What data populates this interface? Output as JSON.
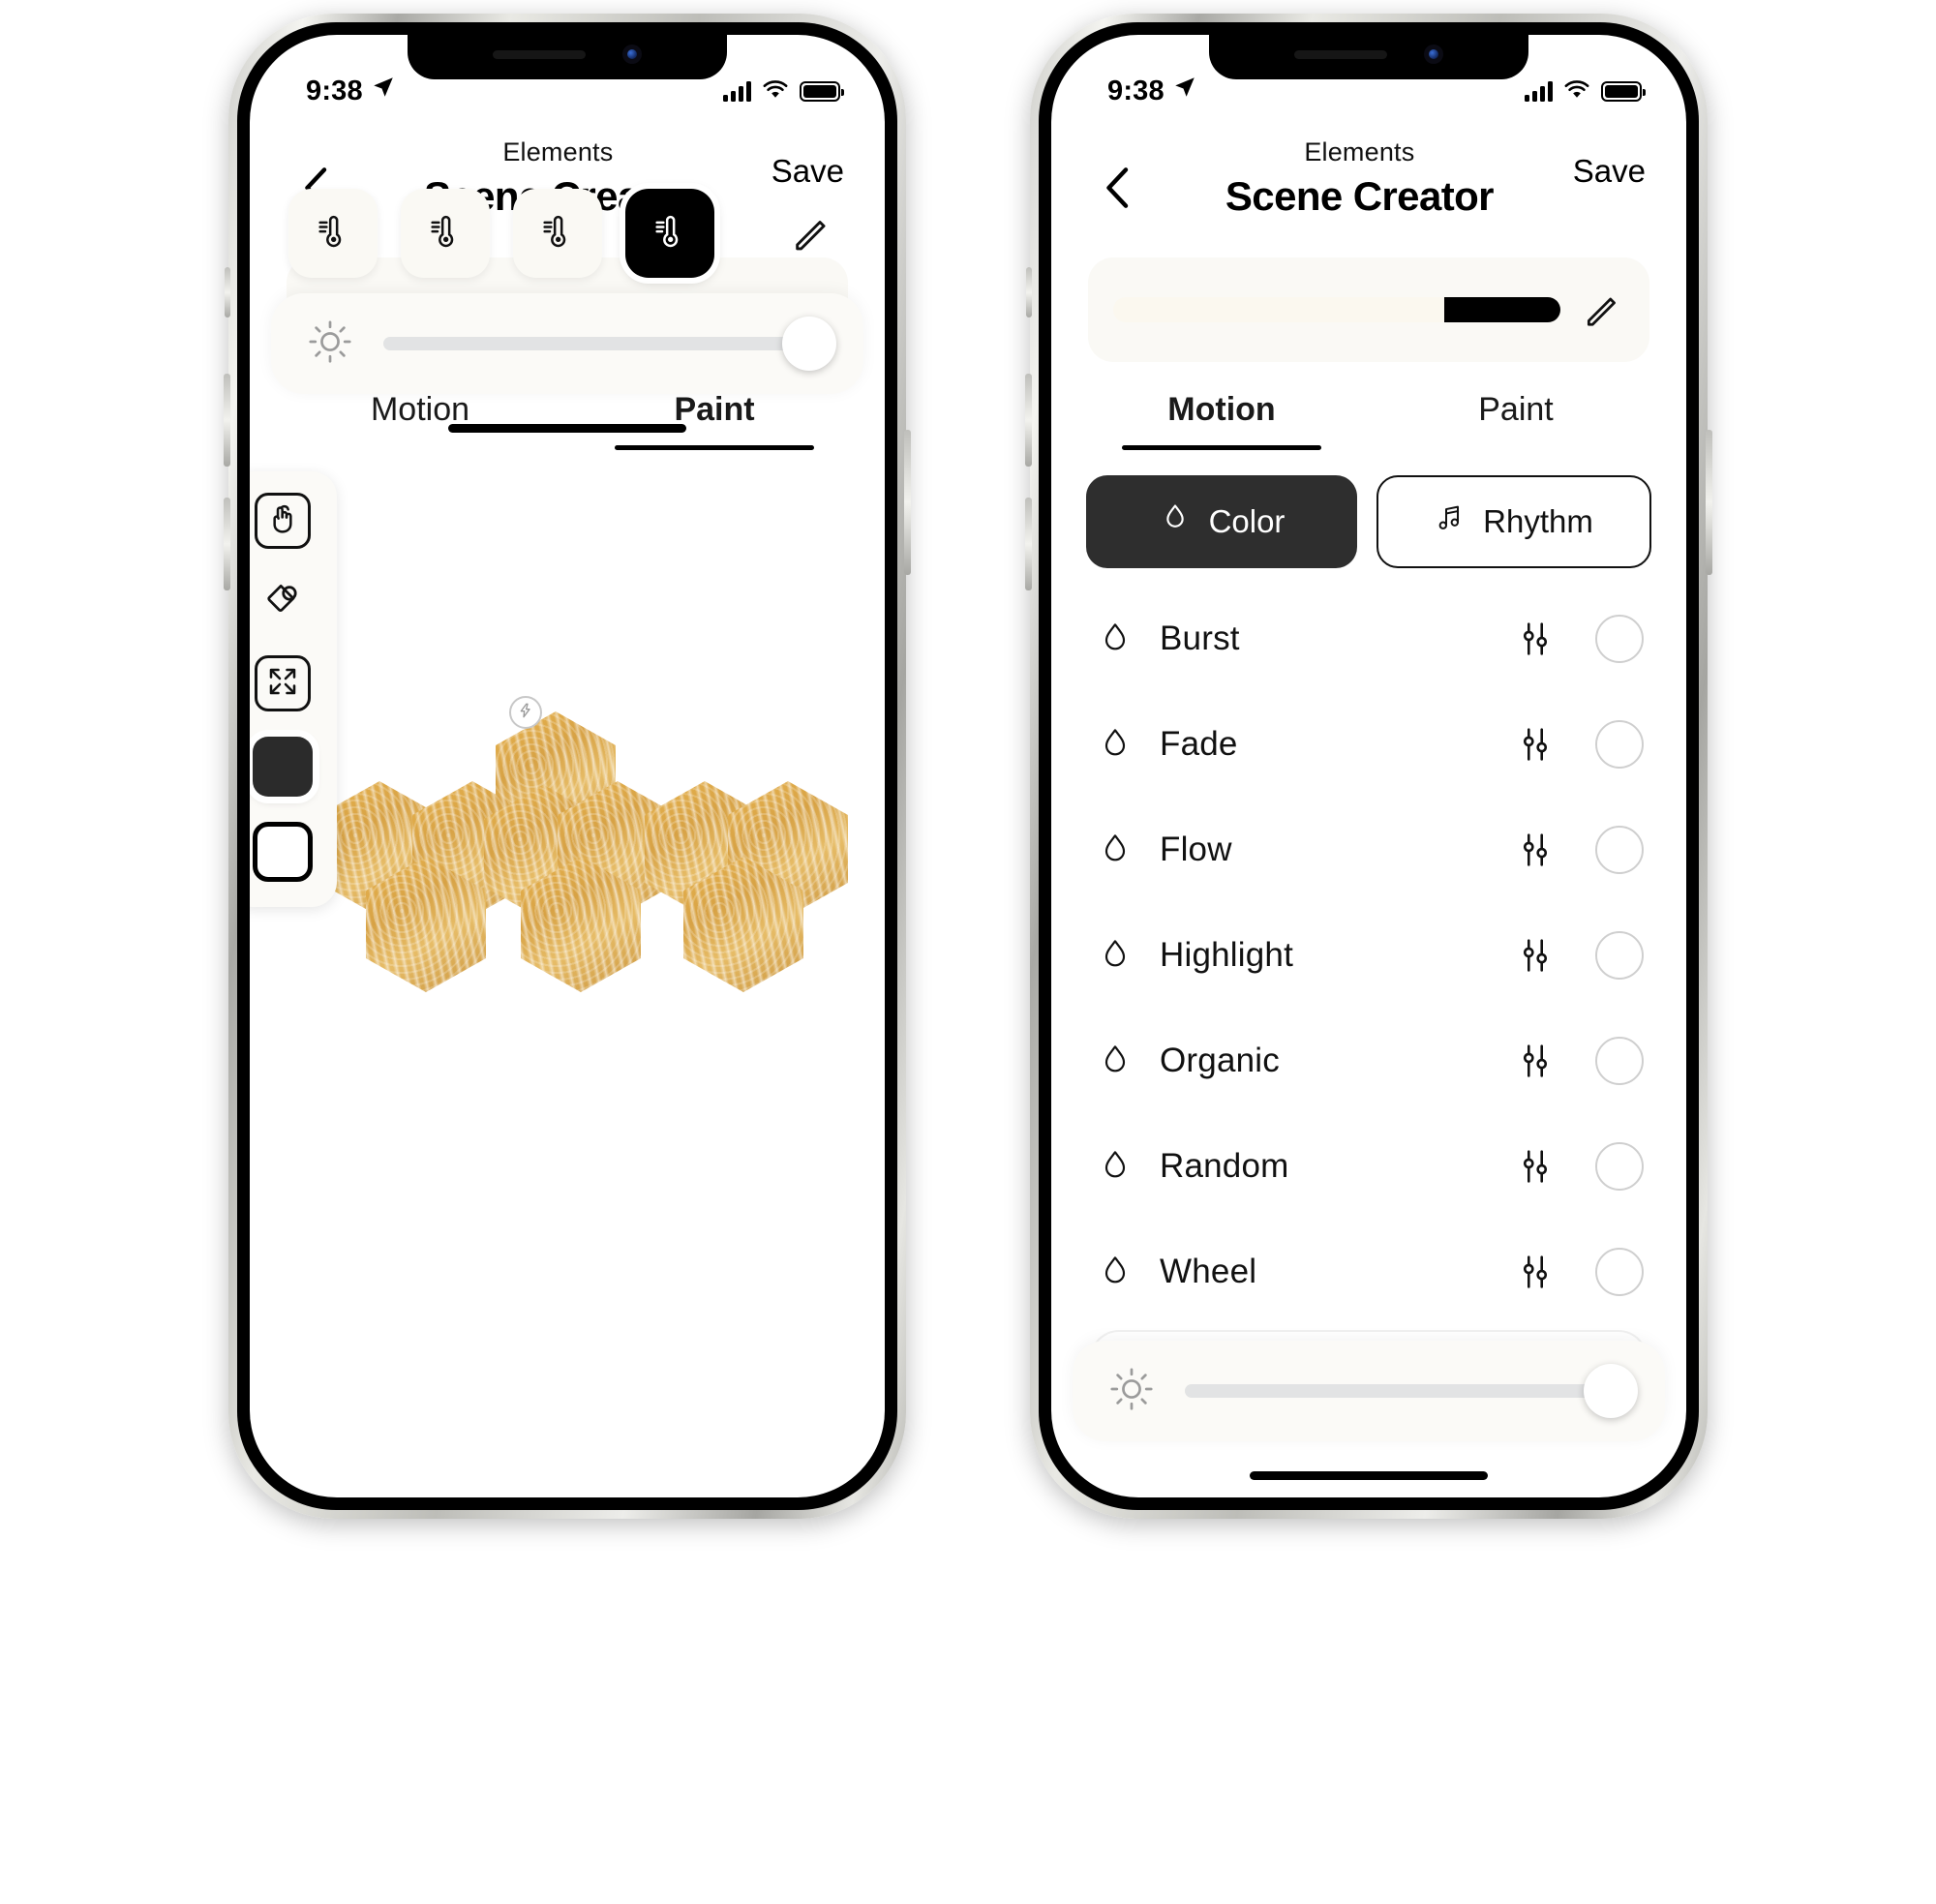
{
  "status_bar": {
    "time": "9:38",
    "location_icon": "location-arrow-icon",
    "signal_icon": "cellular-signal-icon",
    "wifi_icon": "wifi-icon",
    "battery_icon": "battery-full-icon"
  },
  "nav": {
    "back_icon": "chevron-left-icon",
    "subtitle": "Elements",
    "title": "Scene Creator",
    "save_label": "Save"
  },
  "palette_bar": {
    "edit_icon": "pencil-icon",
    "light_stop_pct": 74,
    "light_color": "#fbf8ef",
    "dark_color": "#000000"
  },
  "tabs": {
    "motion_label": "Motion",
    "paint_label": "Paint"
  },
  "left_phone": {
    "active_tab": "Paint",
    "tool_palette": [
      {
        "name": "tap-tool",
        "icon": "hand-tap-icon",
        "selected": true
      },
      {
        "name": "fill-tool",
        "icon": "paint-bucket-icon",
        "selected": false
      },
      {
        "name": "expand-tool",
        "icon": "expand-arrows-icon",
        "selected": false
      }
    ],
    "swatches": [
      {
        "name": "swatch-dark",
        "color": "#2b2b2b",
        "selected": true
      },
      {
        "name": "swatch-light",
        "color": "#ffffff",
        "selected": false
      }
    ],
    "panels": {
      "count": 9,
      "shape": "hexagon",
      "color": "#d8a949",
      "power_badge_icon": "lightning-bolt-icon"
    },
    "temperature_buttons": [
      {
        "name": "temp-1",
        "icon": "thermometer-icon",
        "selected": false
      },
      {
        "name": "temp-2",
        "icon": "thermometer-icon",
        "selected": false
      },
      {
        "name": "temp-3",
        "icon": "thermometer-icon",
        "selected": false
      },
      {
        "name": "temp-4",
        "icon": "thermometer-icon",
        "selected": true
      }
    ],
    "temp_edit_icon": "pencil-icon",
    "brightness": {
      "icon": "brightness-sun-icon",
      "value_pct": 100
    }
  },
  "right_phone": {
    "active_tab": "Motion",
    "segments": [
      {
        "name": "segment-color",
        "label": "Color",
        "icon": "droplet-icon",
        "selected": true
      },
      {
        "name": "segment-rhythm",
        "label": "Rhythm",
        "icon": "music-note-icon",
        "selected": false
      }
    ],
    "effects": [
      {
        "label": "Burst",
        "icon": "droplet-icon",
        "settings_icon": "sliders-icon",
        "selected": false
      },
      {
        "label": "Fade",
        "icon": "droplet-icon",
        "settings_icon": "sliders-icon",
        "selected": false
      },
      {
        "label": "Flow",
        "icon": "droplet-icon",
        "settings_icon": "sliders-icon",
        "selected": false
      },
      {
        "label": "Highlight",
        "icon": "droplet-icon",
        "settings_icon": "sliders-icon",
        "selected": false
      },
      {
        "label": "Organic",
        "icon": "droplet-icon",
        "settings_icon": "sliders-icon",
        "selected": false
      },
      {
        "label": "Random",
        "icon": "droplet-icon",
        "settings_icon": "sliders-icon",
        "selected": false
      },
      {
        "label": "Wheel",
        "icon": "droplet-icon",
        "settings_icon": "sliders-icon",
        "selected": false
      }
    ],
    "brightness": {
      "icon": "brightness-sun-icon",
      "value_pct": 100
    }
  }
}
